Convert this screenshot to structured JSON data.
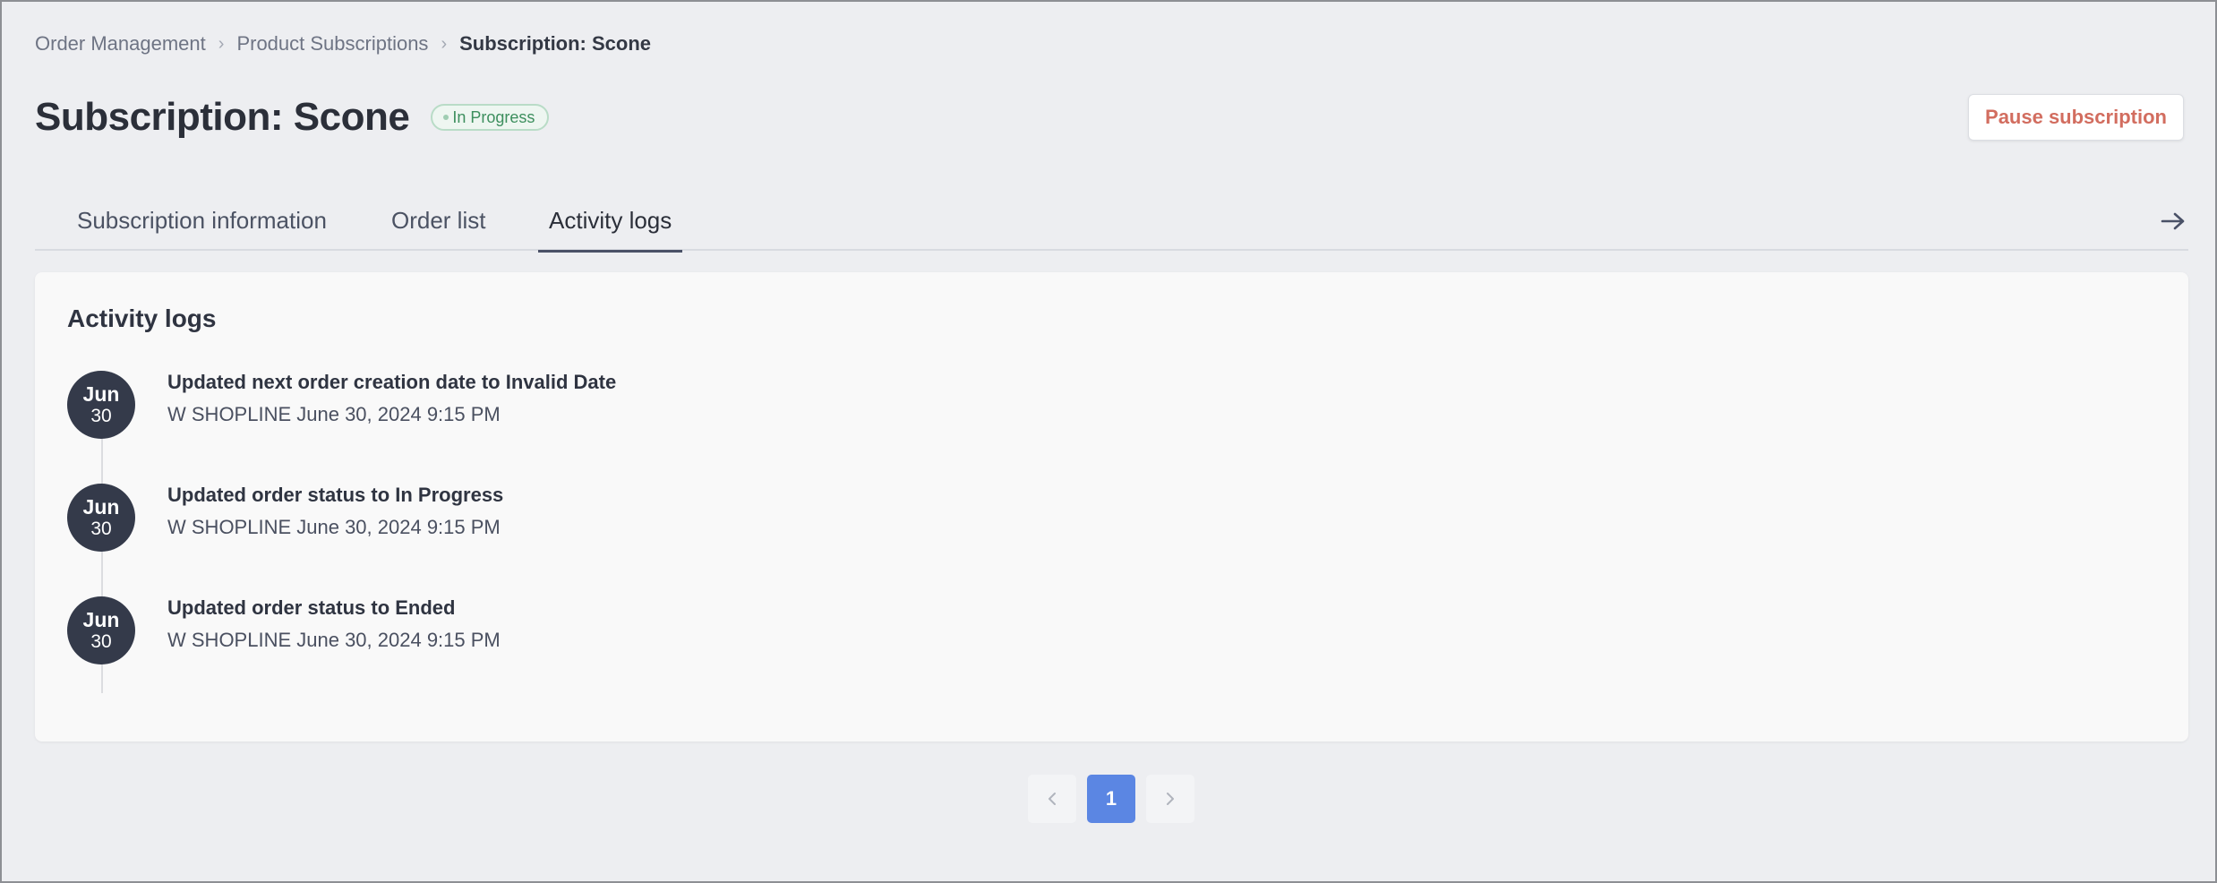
{
  "breadcrumb": {
    "items": [
      "Order Management",
      "Product Subscriptions"
    ],
    "current": "Subscription: Scone",
    "separator": "›"
  },
  "header": {
    "title": "Subscription: Scone",
    "status_badge": "In Progress",
    "pause_button": "Pause subscription"
  },
  "tabs": [
    {
      "label": "Subscription information",
      "active": false
    },
    {
      "label": "Order list",
      "active": false
    },
    {
      "label": "Activity logs",
      "active": true
    }
  ],
  "activity": {
    "title": "Activity logs",
    "logs": [
      {
        "month": "Jun",
        "day": "30",
        "title": "Updated next order creation date to Invalid Date",
        "meta": "W SHOPLINE June 30, 2024 9:15 PM"
      },
      {
        "month": "Jun",
        "day": "30",
        "title": "Updated order status to In Progress",
        "meta": "W SHOPLINE June 30, 2024 9:15 PM"
      },
      {
        "month": "Jun",
        "day": "30",
        "title": "Updated order status to Ended",
        "meta": "W SHOPLINE June 30, 2024 9:15 PM"
      }
    ]
  },
  "pagination": {
    "current_page": "1"
  },
  "icons": {
    "tab_scroll": "arrow-right-icon",
    "prev": "chevron-left-icon",
    "next": "chevron-right-icon"
  },
  "colors": {
    "accent": "#5b86e3",
    "pause_text": "#d26d5f",
    "status_green": "#3d8f5e",
    "date_bubble": "#343a4a"
  }
}
